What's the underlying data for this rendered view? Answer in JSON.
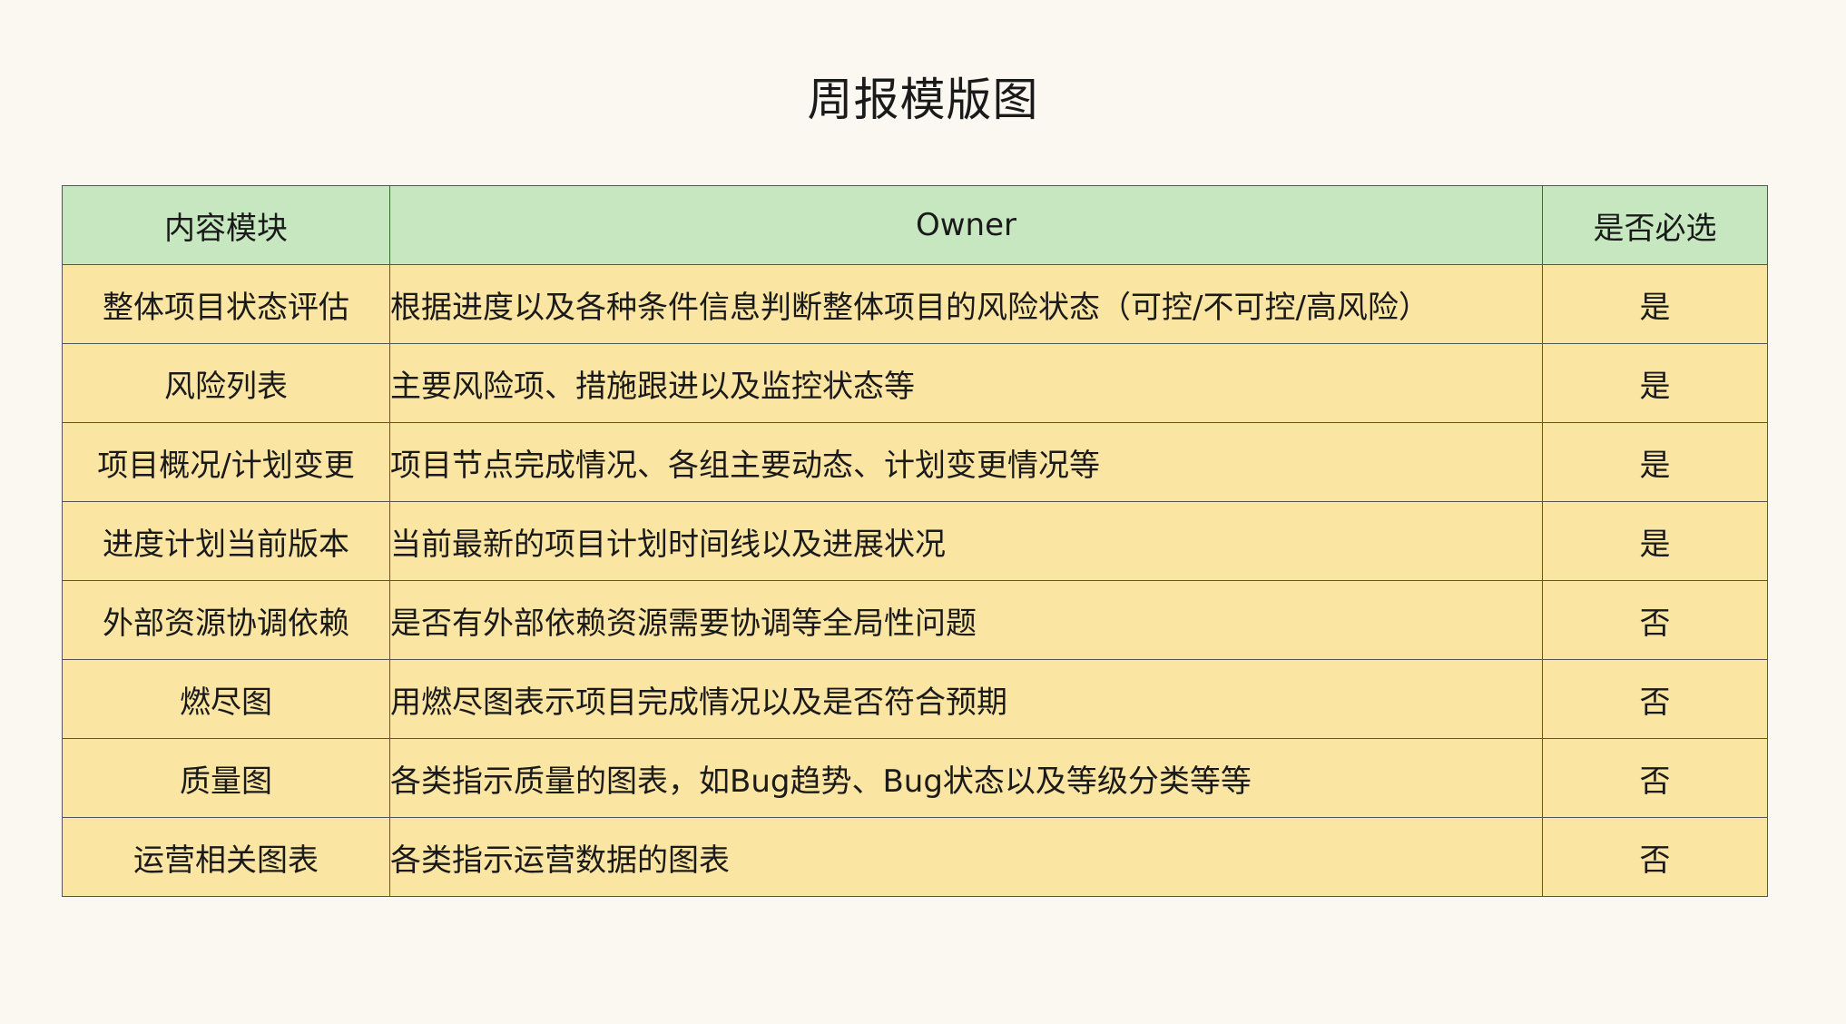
{
  "title": "周报模版图",
  "table": {
    "headers": [
      "内容模块",
      "Owner",
      "是否必选"
    ],
    "rows": [
      {
        "module": "整体项目状态评估",
        "description": "根据进度以及各种条件信息判断整体项目的风险状态（可控/不可控/高风险）",
        "required": "是"
      },
      {
        "module": "风险列表",
        "description": "主要风险项、措施跟进以及监控状态等",
        "required": "是"
      },
      {
        "module": "项目概况/计划变更",
        "description": "项目节点完成情况、各组主要动态、计划变更情况等",
        "required": "是"
      },
      {
        "module": "进度计划当前版本",
        "description": "当前最新的项目计划时间线以及进展状况",
        "required": "是"
      },
      {
        "module": "外部资源协调依赖",
        "description": "是否有外部依赖资源需要协调等全局性问题",
        "required": "否"
      },
      {
        "module": "燃尽图",
        "description": "用燃尽图表示项目完成情况以及是否符合预期",
        "required": "否"
      },
      {
        "module": "质量图",
        "description": "各类指示质量的图表，如Bug趋势、Bug状态以及等级分类等等",
        "required": "否"
      },
      {
        "module": "运营相关图表",
        "description": "各类指示运营数据的图表",
        "required": "否"
      }
    ]
  }
}
